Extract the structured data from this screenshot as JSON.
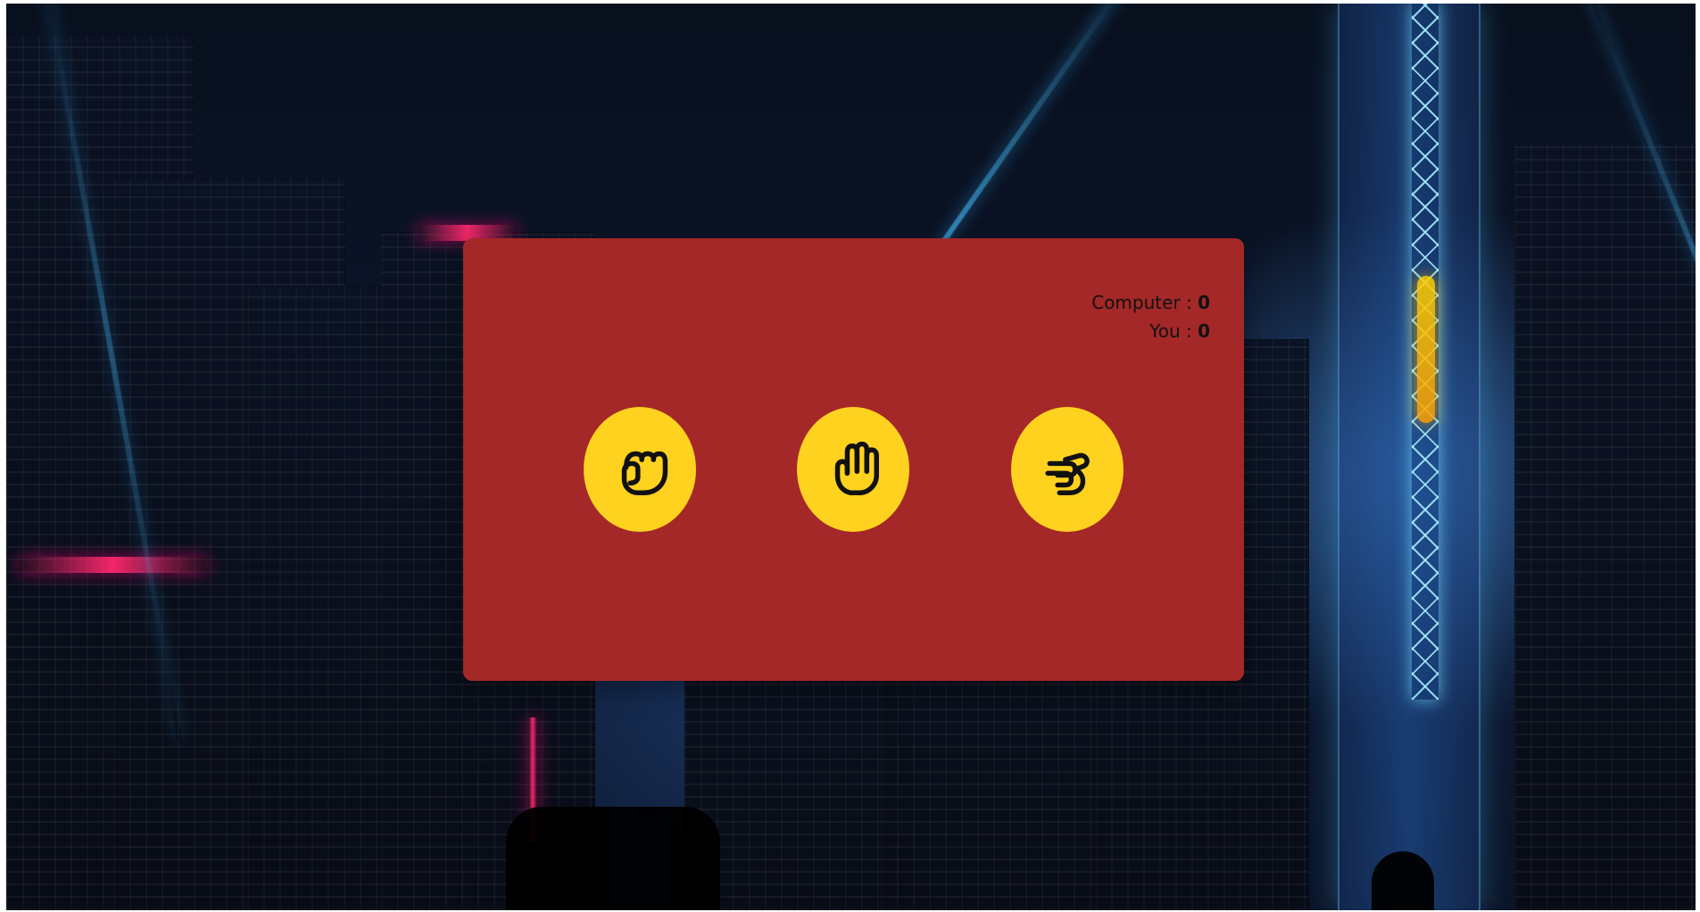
{
  "scoreboard": {
    "computer_label": "Computer : ",
    "computer_score": "0",
    "you_label": "You : ",
    "you_score": "0"
  },
  "choices": [
    {
      "id": "rock",
      "icon": "fist-icon",
      "button_color": "#ffd21f"
    },
    {
      "id": "paper",
      "icon": "open-hand-icon",
      "button_color": "#ffd21f"
    },
    {
      "id": "scissors",
      "icon": "scissors-hand-icon",
      "button_color": "#ffd21f"
    }
  ],
  "colors": {
    "panel_bg": "#a42828",
    "text": "#111111",
    "choice_bg": "#ffd21f"
  }
}
